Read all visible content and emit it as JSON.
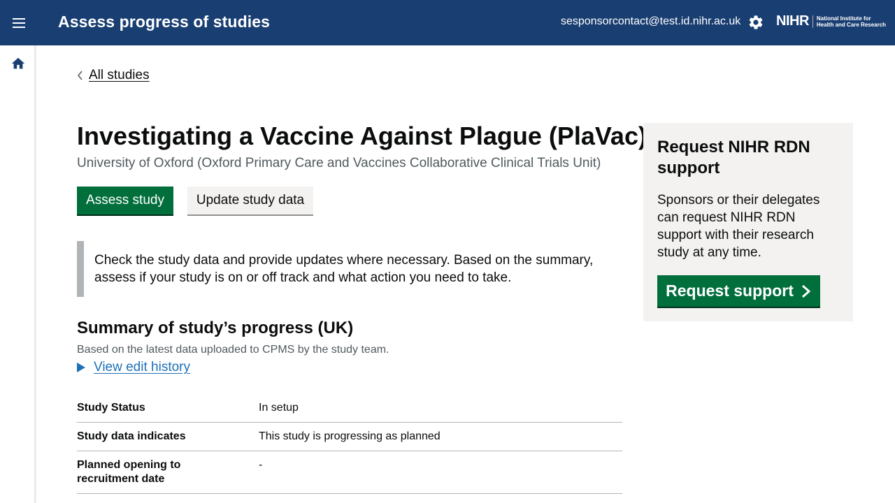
{
  "header": {
    "app_title": "Assess progress of studies",
    "user_email": "sesponsorcontact@test.id.nihr.ac.uk",
    "logo_mark": "NIHR",
    "logo_text_line1": "National Institute for",
    "logo_text_line2": "Health and Care Research",
    "menu_icon": "menu-icon",
    "settings_icon": "gear-icon"
  },
  "sidenav": {
    "home_icon": "home-icon"
  },
  "back_link": {
    "label": "All studies"
  },
  "study": {
    "title": "Investigating a Vaccine Against Plague (PlaVac)",
    "organisation": "University of Oxford (Oxford Primary Care and Vaccines Collaborative Clinical Trials Unit)"
  },
  "actions": {
    "assess_label": "Assess study",
    "update_label": "Update study data"
  },
  "inset_text": "Check the study data and provide updates where necessary. Based on the summary, assess if your study is on or off track and what action you need to take.",
  "summary": {
    "heading": "Summary of study’s progress (UK)",
    "hint": "Based on the latest data uploaded to CPMS by the study team.",
    "details_label": "View edit history",
    "rows": [
      {
        "key": "Study Status",
        "value": "In setup"
      },
      {
        "key": "Study data indicates",
        "value": "This study is progressing as planned"
      },
      {
        "key": "Planned opening to recruitment date",
        "value": "-"
      }
    ]
  },
  "aside": {
    "heading": "Request NIHR RDN support",
    "text": "Sponsors or their delegates can request NIHR RDN support with their research study at any time.",
    "button_label": "Request support"
  },
  "colors": {
    "header_bg": "#193e72",
    "primary_green": "#006f3c",
    "link_blue": "#1d70b8",
    "panel_grey": "#f3f2f1"
  }
}
